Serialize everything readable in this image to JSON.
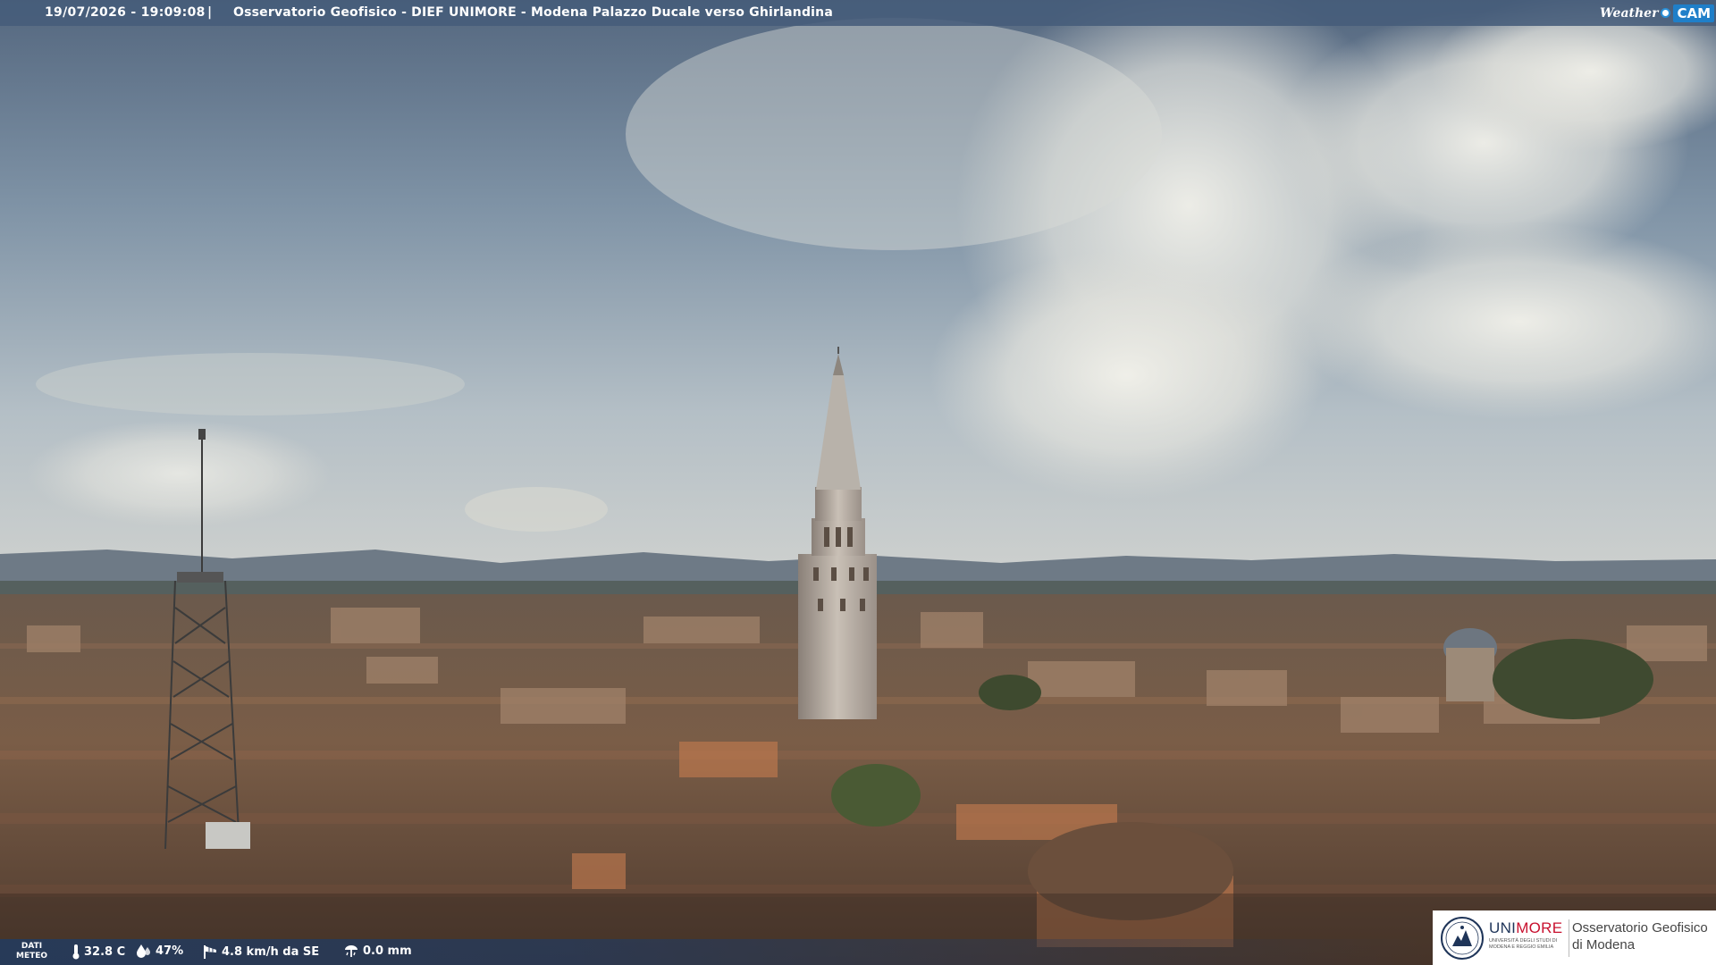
{
  "header": {
    "datetime": "19/07/2026 - 19:09:08",
    "separator": "|",
    "caption": "Osservatorio Geofisico - DIEF UNIMORE - Modena Palazzo Ducale verso Ghirlandina",
    "brand_weather": "Weather",
    "brand_cam": "CAM"
  },
  "footer": {
    "dati_label_1": "DATI",
    "dati_label_2": "METEO",
    "temperature": "32.8 C",
    "humidity": "47%",
    "wind": "4.8 km/h da SE",
    "rain": "0.0 mm",
    "icons": [
      "thermometer-icon",
      "humidity-drop-icon",
      "wind-sock-icon",
      "rain-gauge-icon"
    ]
  },
  "logo": {
    "name_uni": "UNI",
    "name_more": "MORE",
    "sub_1": "UNIVERSITÀ DEGLI STUDI DI",
    "sub_2": "MODENA E REGGIO EMILIA",
    "observatory_1": "Osservatorio Geofisico",
    "observatory_2": "di Modena"
  },
  "colors": {
    "bar_blue": "#465c7a",
    "cam_blue": "#1f7fc9",
    "unimore_red": "#c8102e",
    "unimore_navy": "#1f3559"
  }
}
